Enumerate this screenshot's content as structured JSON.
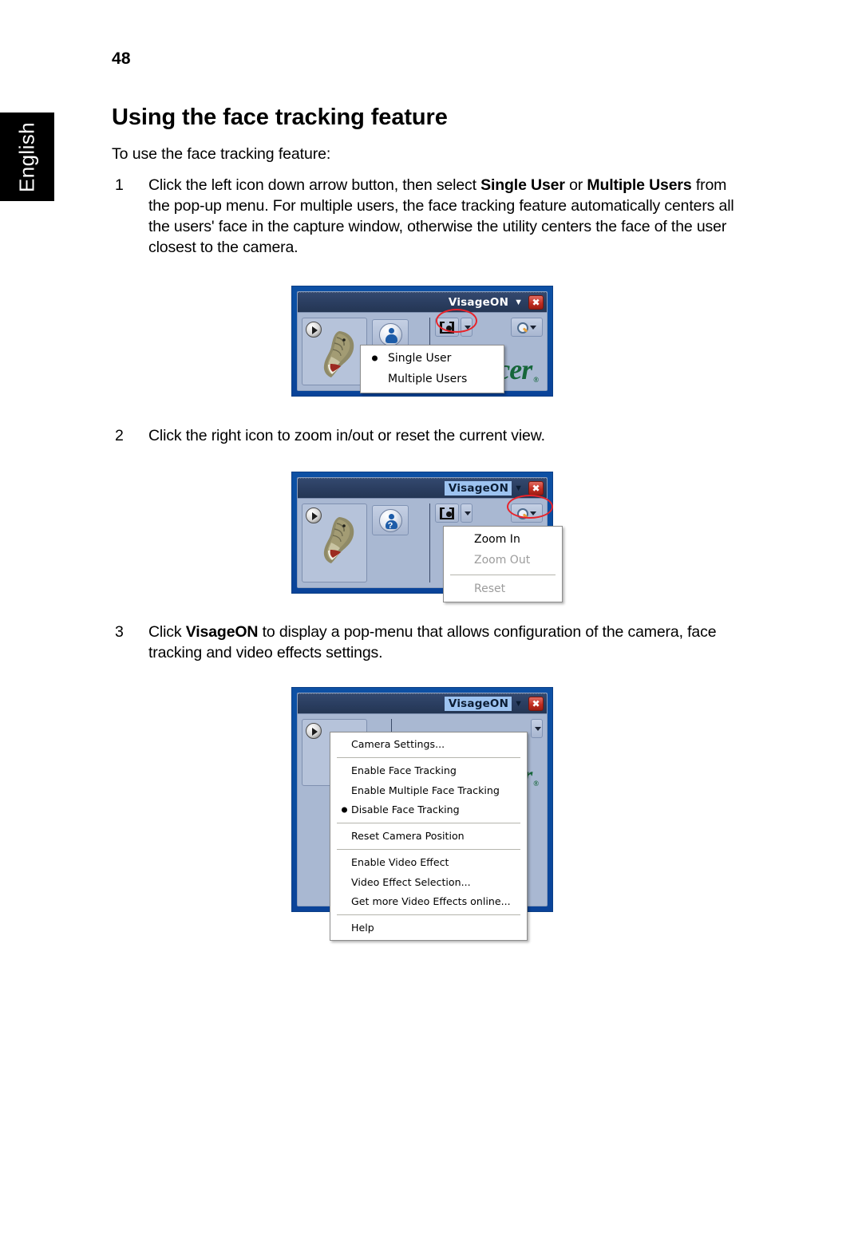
{
  "sidebar": {
    "language_tab": "English"
  },
  "page": {
    "number": "48",
    "heading": "Using the face tracking feature",
    "lead": "To use the face tracking feature:"
  },
  "steps": [
    {
      "number": "1",
      "text_parts": [
        {
          "text": "Click the left icon down arrow button, then select ",
          "bold": false
        },
        {
          "text": "Single User",
          "bold": true
        },
        {
          "text": " or ",
          "bold": false
        },
        {
          "text": "Multiple Users",
          "bold": true
        },
        {
          "text": " from the pop-up menu. For multiple users, the face tracking feature automatically centers all the users' face in the capture window, otherwise the utility centers the face of the user closest to the camera.",
          "bold": false
        }
      ]
    },
    {
      "number": "2",
      "text_parts": [
        {
          "text": "Click the right icon to zoom in/out or reset the current view.",
          "bold": false
        }
      ]
    },
    {
      "number": "3",
      "text_parts": [
        {
          "text": "Click ",
          "bold": false
        },
        {
          "text": "VisageON",
          "bold": true
        },
        {
          "text": " to display a pop-menu that allows configuration of the camera, face tracking and video effects settings.",
          "bold": false
        }
      ]
    }
  ],
  "figures": [
    {
      "id": "figure-1",
      "titlebar": {
        "app_name": "VisageON",
        "caret": "▼",
        "close_label": "✖",
        "highlighted": false
      },
      "logo": {
        "text": "cer",
        "registered": "®"
      },
      "menu": {
        "items": [
          {
            "label": "Single User",
            "checked": true,
            "disabled": false
          },
          {
            "label": "Multiple Users",
            "checked": false,
            "disabled": false
          }
        ]
      }
    },
    {
      "id": "figure-2",
      "titlebar": {
        "app_name": "VisageON",
        "caret": "▼",
        "close_label": "✖",
        "highlighted": true
      },
      "menu": {
        "items": [
          {
            "label": "Zoom In",
            "disabled": false,
            "separator_after": false
          },
          {
            "label": "Zoom Out",
            "disabled": true,
            "separator_after": true
          },
          {
            "label": "Reset",
            "disabled": true,
            "separator_after": false
          }
        ]
      }
    },
    {
      "id": "figure-3",
      "titlebar": {
        "app_name": "VisageON",
        "caret": "▼",
        "close_label": "✖",
        "highlighted": true
      },
      "menu": {
        "items": [
          {
            "label": "Camera Settings...",
            "checked": false,
            "separator_after": true
          },
          {
            "label": "Enable Face Tracking",
            "checked": false,
            "separator_after": false
          },
          {
            "label": "Enable Multiple Face Tracking",
            "checked": false,
            "separator_after": false
          },
          {
            "label": "Disable Face Tracking",
            "checked": true,
            "separator_after": true
          },
          {
            "label": "Reset Camera Position",
            "checked": false,
            "separator_after": true
          },
          {
            "label": "Enable Video Effect",
            "checked": false,
            "separator_after": false
          },
          {
            "label": "Video Effect Selection...",
            "checked": false,
            "separator_after": false
          },
          {
            "label": "Get more Video Effects online...",
            "checked": false,
            "separator_after": true
          },
          {
            "label": "Help",
            "checked": false,
            "separator_after": false
          }
        ]
      }
    }
  ],
  "colors": {
    "figure_background": "#0a4da0",
    "titlebar": "#2a3d5f",
    "window_face": "#a9b8d2",
    "highlight": "#9dc3f0",
    "annotation": "#e8232a",
    "acer_green": "#16663a",
    "close_button": "#c32e22"
  }
}
